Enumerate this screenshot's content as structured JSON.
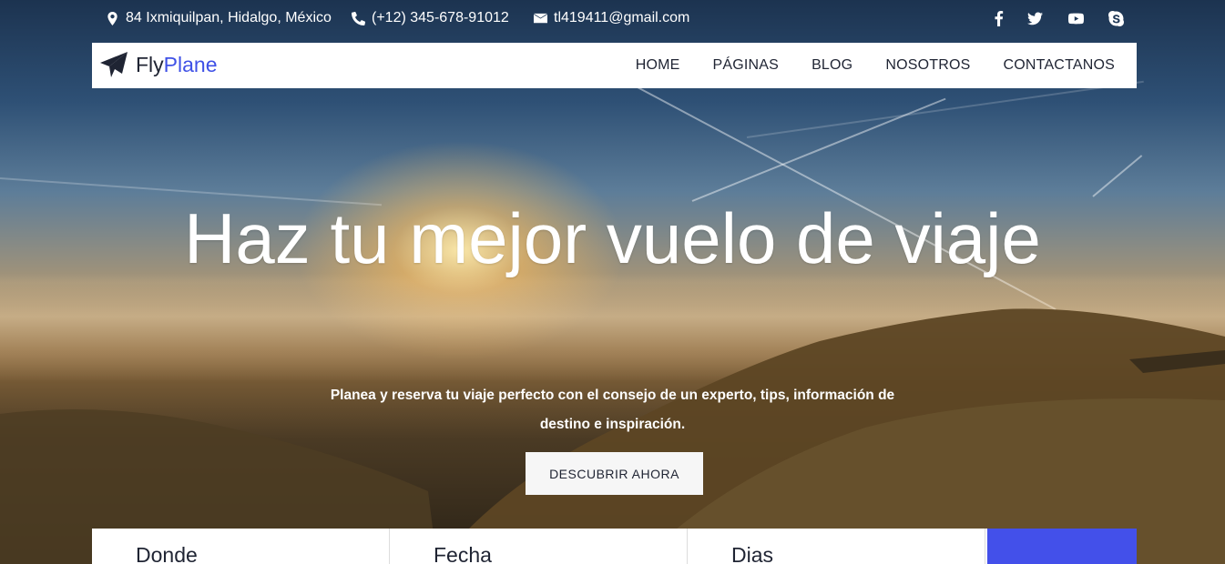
{
  "topbar": {
    "address": "84 Ixmiquilpan, Hidalgo, México",
    "phone": "(+12) 345-678-91012",
    "email": "tl419411@gmail.com",
    "social_icons": [
      "facebook-icon",
      "twitter-icon",
      "youtube-icon",
      "skype-icon"
    ]
  },
  "brand": {
    "name_part1": "Fly",
    "name_part2": "Plane",
    "accent_color": "#3f51e6"
  },
  "nav": {
    "items": [
      {
        "label": "HOME"
      },
      {
        "label": "PÁGINAS"
      },
      {
        "label": "BLOG"
      },
      {
        "label": "NOSOTROS"
      },
      {
        "label": "CONTACTANOS"
      }
    ]
  },
  "hero": {
    "headline": "Haz tu mejor vuelo de viaje",
    "subtitle": "Planea y reserva tu viaje perfecto con el consejo de un experto, tips, información de destino e inspiración.",
    "cta_label": "DESCUBRIR AHORA"
  },
  "search": {
    "fields": [
      {
        "label": "Donde"
      },
      {
        "label": "Fecha"
      },
      {
        "label": "Dias"
      }
    ],
    "submit_color": "#4350ea"
  }
}
